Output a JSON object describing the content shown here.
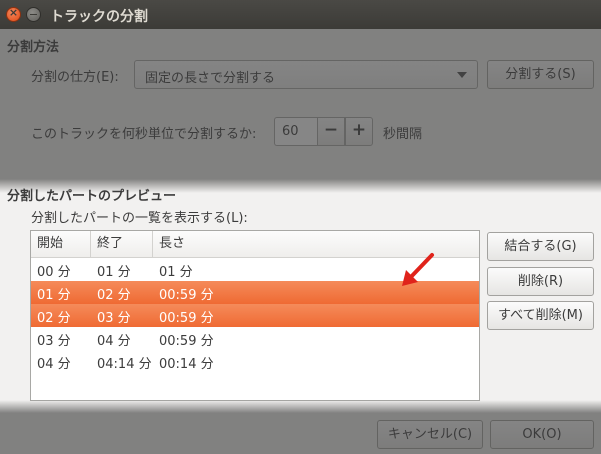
{
  "window": {
    "title": "トラックの分割"
  },
  "method": {
    "heading": "分割方法",
    "mode_label": "分割の仕方(E):",
    "mode_value": "固定の長さで分割する",
    "split_button": "分割する(S)",
    "seconds_label": "このトラックを何秒単位で分割するか:",
    "seconds_value": "60",
    "minus": "−",
    "plus": "+",
    "seconds_suffix": "秒間隔"
  },
  "preview": {
    "heading": "分割したパートのプレビュー",
    "list_label": "分割したパートの一覧を表示する(L):",
    "columns": [
      "開始",
      "終了",
      "長さ"
    ],
    "rows": [
      {
        "start": "00 分",
        "end": "01 分",
        "length": "01 分",
        "selected": false
      },
      {
        "start": "01 分",
        "end": "02 分",
        "length": "00:59 分",
        "selected": true
      },
      {
        "start": "02 分",
        "end": "03 分",
        "length": "00:59 分",
        "selected": true
      },
      {
        "start": "03 分",
        "end": "04 分",
        "length": "00:59 分",
        "selected": false
      },
      {
        "start": "04 分",
        "end": "04:14 分",
        "length": "00:14 分",
        "selected": false
      }
    ],
    "merge_button": "結合する(G)",
    "delete_button": "削除(R)",
    "delete_all_button": "すべて削除(M)"
  },
  "footer": {
    "cancel_button": "キャンセル(C)",
    "ok_button": "OK(O)"
  },
  "colors": {
    "selection": "#ef6a33",
    "annotation_arrow": "#e0231b",
    "titlebar": "#3c3b37"
  },
  "annotation": {
    "icon": "red-arrow-icon"
  }
}
